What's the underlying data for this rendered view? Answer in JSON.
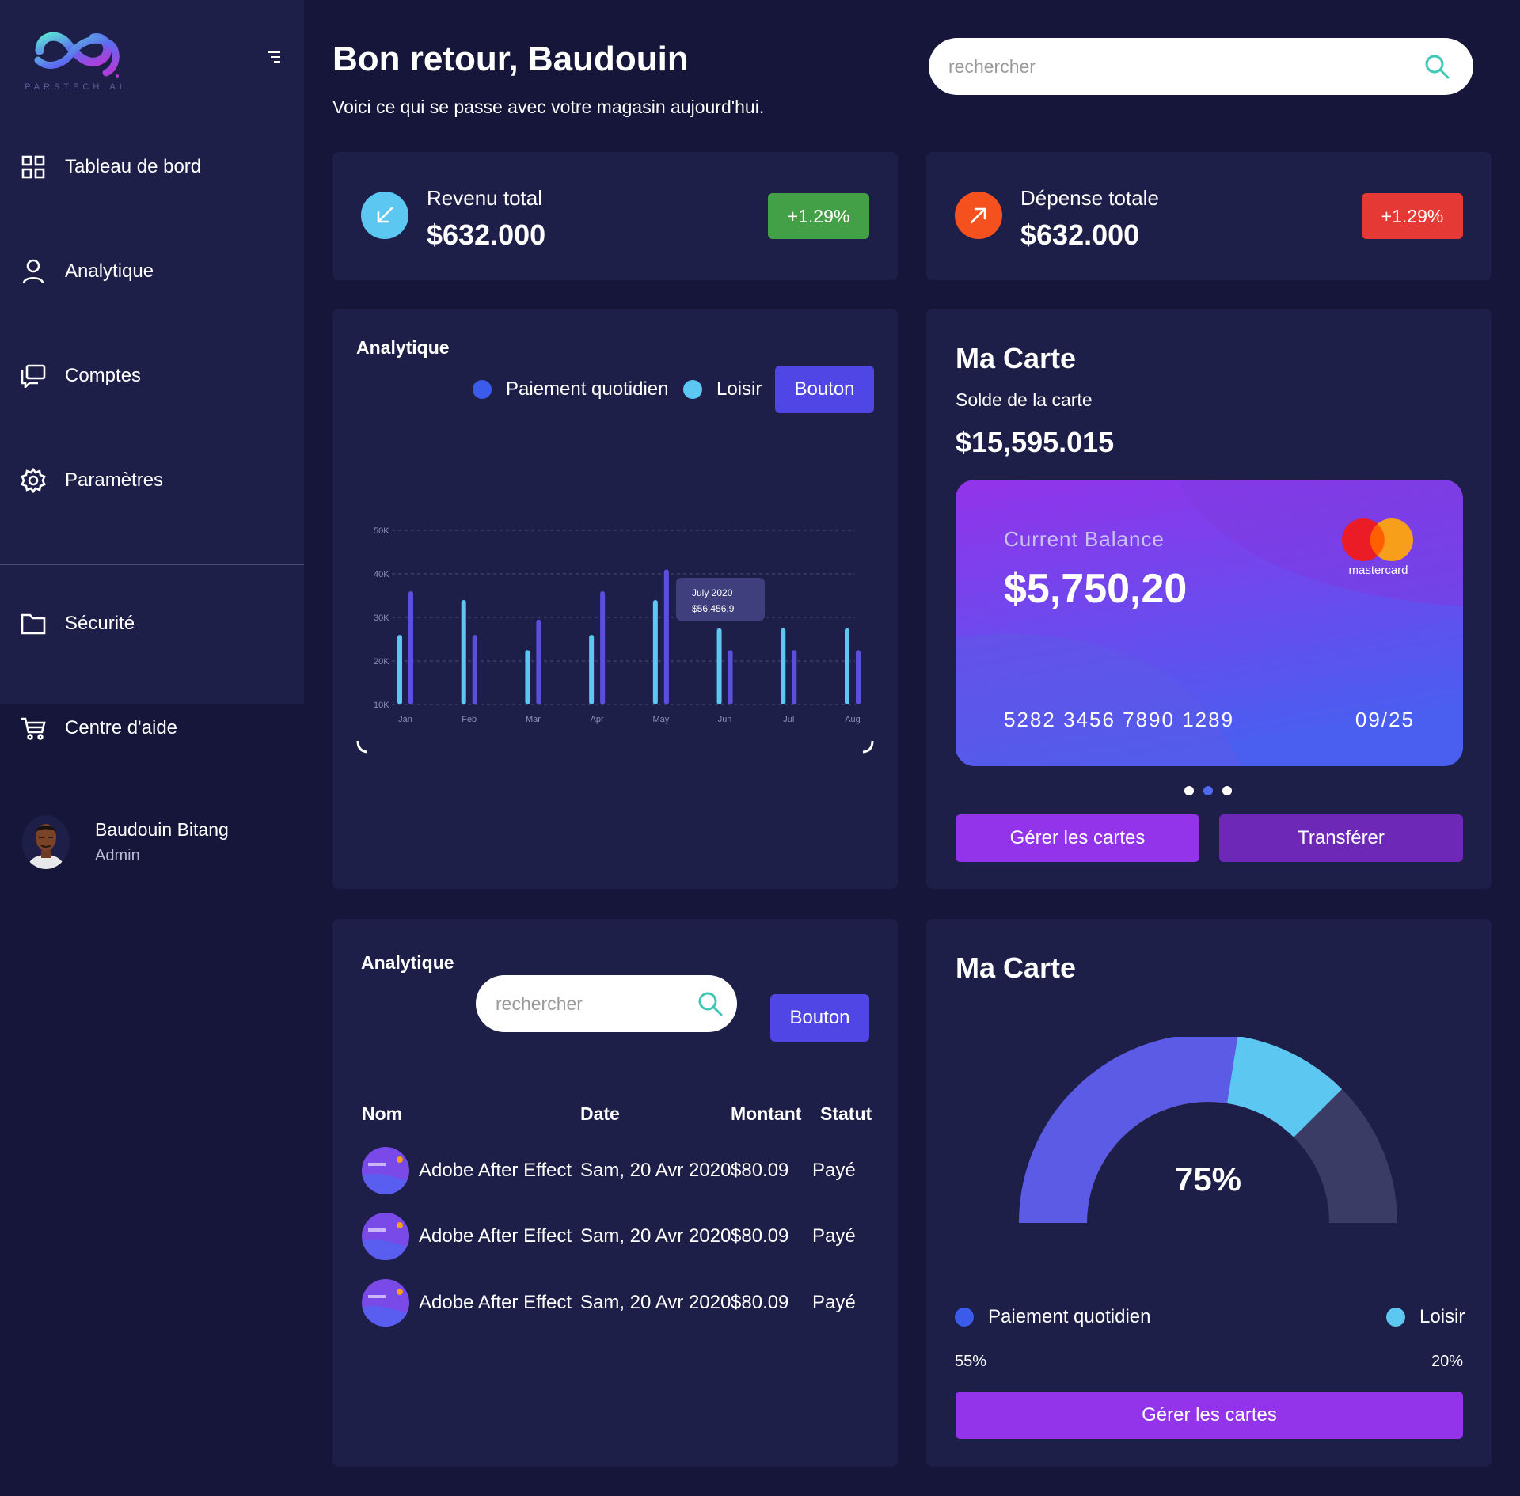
{
  "brand": {
    "logo_text": "PARSTECH.AI"
  },
  "sidebar": {
    "items": [
      {
        "label": "Tableau de bord",
        "icon": "grid-icon"
      },
      {
        "label": "Analytique",
        "icon": "user-icon"
      },
      {
        "label": "Comptes",
        "icon": "chat-icon"
      },
      {
        "label": "Paramètres",
        "icon": "gear-icon"
      },
      {
        "label": "Sécurité",
        "icon": "folder-icon"
      },
      {
        "label": "Centre d'aide",
        "icon": "cart-icon"
      }
    ]
  },
  "user": {
    "name": "Baudouin Bitang",
    "role": "Admin"
  },
  "header": {
    "greeting": "Bon retour, Baudouin",
    "subtitle": "Voici ce qui se passe avec votre magasin aujourd'hui.",
    "search_placeholder": "rechercher"
  },
  "stats": {
    "revenue": {
      "label": "Revenu total",
      "value": "$632.000",
      "badge": "+1.29%",
      "icon": "arrow-down-left-icon"
    },
    "expense": {
      "label": "Dépense totale",
      "value": "$632.000",
      "badge": "+1.29%",
      "icon": "arrow-up-right-icon"
    }
  },
  "analytics_chart_card": {
    "title": "Analytique",
    "legend": [
      "Paiement quotidien",
      "Loisir"
    ],
    "button": "Bouton"
  },
  "chart_data": {
    "type": "bar",
    "categories": [
      "Jan",
      "Feb",
      "Mar",
      "Apr",
      "May",
      "Jun",
      "Jul",
      "Aug"
    ],
    "series": [
      {
        "name": "Paiement quotidien",
        "color": "#5b4fe0",
        "values": [
          36000,
          26000,
          29500,
          36000,
          41000,
          22500,
          22500,
          22500
        ]
      },
      {
        "name": "Loisir",
        "color": "#5cc8f2",
        "values": [
          26000,
          34000,
          22500,
          26000,
          34000,
          27500,
          27500,
          27500
        ]
      }
    ],
    "y_ticks": [
      "10K",
      "20K",
      "30K",
      "40K",
      "50K"
    ],
    "ylim": [
      10000,
      50000
    ],
    "tooltip": {
      "title": "July 2020",
      "value": "$56.456,9"
    },
    "grid": true
  },
  "card_panel": {
    "title": "Ma Carte",
    "balance_label": "Solde de la carte",
    "balance": "$15,595.015",
    "credit_card": {
      "balance_label": "Current Balance",
      "balance": "$5,750,20",
      "brand": "mastercard",
      "number": "5282 3456 7890 1289",
      "expiry": "09/25"
    },
    "buttons": {
      "manage": "Gérer les cartes",
      "transfer": "Transférer"
    },
    "carousel_active_index": 1,
    "colors": {
      "manage": "#9333ea",
      "transfer": "#6d28b8"
    }
  },
  "transactions_card": {
    "title": "Analytique",
    "search_placeholder": "rechercher",
    "button": "Bouton",
    "columns": [
      "Nom",
      "Date",
      "Montant",
      "Statut"
    ],
    "rows": [
      {
        "name": "Adobe After Effect",
        "date": "Sam, 20 Avr 2020",
        "amount": "$80.09",
        "status": "Payé"
      },
      {
        "name": "Adobe After Effect",
        "date": "Sam, 20 Avr 2020",
        "amount": "$80.09",
        "status": "Payé"
      },
      {
        "name": "Adobe After Effect",
        "date": "Sam, 20 Avr 2020",
        "amount": "$80.09",
        "status": "Payé"
      }
    ]
  },
  "gauge_card": {
    "title": "Ma Carte",
    "percent_label": "75%",
    "segments": {
      "daily": 0.55,
      "leisure": 0.2,
      "rest": 0.25
    },
    "legend": [
      {
        "label": "Paiement quotidien",
        "value": "55%"
      },
      {
        "label": "Loisir",
        "value": "20%"
      }
    ],
    "button": "Gérer les cartes"
  },
  "colors": {
    "bg": "#15163a",
    "panel": "#1e1f48",
    "accent_blue": "#4f46e5",
    "accent_purple": "#9333ea",
    "cyan": "#5cc8f2",
    "green_badge": "#43a047",
    "red_badge": "#e53935"
  }
}
